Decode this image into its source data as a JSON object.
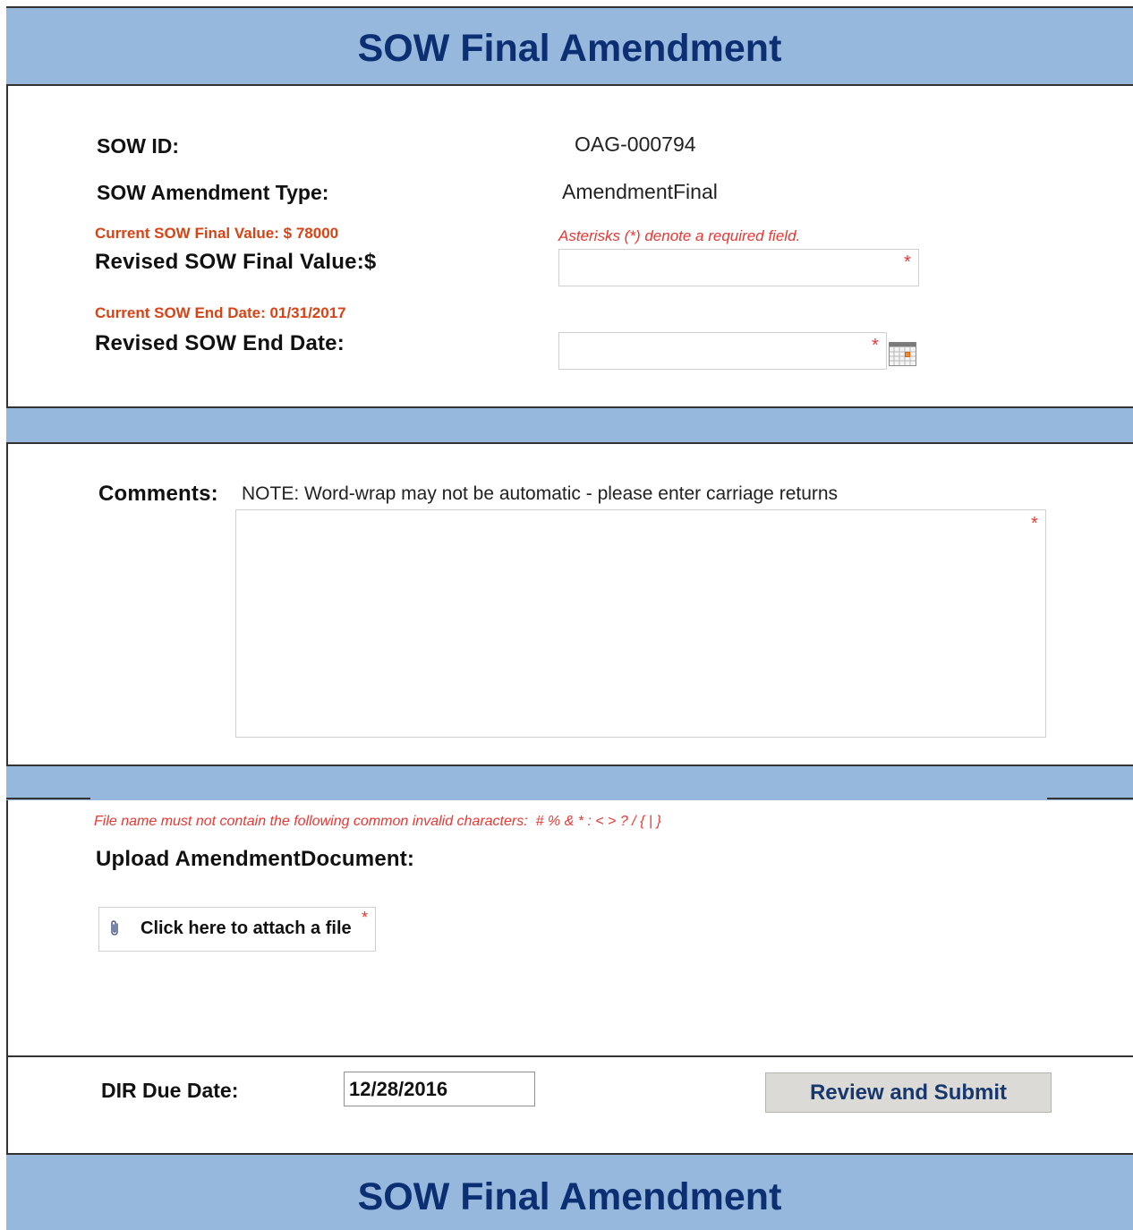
{
  "header": {
    "title": "SOW Final Amendment"
  },
  "footer": {
    "title": "SOW Final Amendment"
  },
  "details": {
    "sow_id_label": "SOW ID:",
    "sow_id_value": "OAG-000794",
    "amendment_type_label": "SOW Amendment Type:",
    "amendment_type_value": "AmendmentFinal",
    "current_final_value_label": "Current SOW Final Value: $",
    "current_final_value": "78000",
    "required_note": "Asterisks (*) denote a required field.",
    "revised_final_value_label": "Revised SOW Final Value:$",
    "revised_final_value": "",
    "current_end_date_label": "Current SOW End Date:",
    "current_end_date": "01/31/2017",
    "revised_end_date_label": "Revised SOW End Date:",
    "revised_end_date": ""
  },
  "comments": {
    "label": "Comments:",
    "note": "NOTE: Word-wrap may not be automatic - please enter carriage returns",
    "value": ""
  },
  "upload": {
    "invalid_chars_note": "File name must not contain the following common invalid characters:  # % & * : < > ? / { | }",
    "label": "Upload AmendmentDocument:",
    "attach_label": "Click here to attach a file"
  },
  "submit_row": {
    "due_date_label": "DIR Due Date:",
    "due_date_value": "12/28/2016",
    "submit_label": "Review and Submit"
  },
  "required_marker": "*",
  "icons": [
    "calendar-icon",
    "paperclip-icon"
  ],
  "colors": {
    "band": "#95b8dc",
    "title": "#0c2f73",
    "current_value": "#d84315",
    "required": "#e53935",
    "button": "#dcdad6",
    "button_text": "#17386e"
  }
}
